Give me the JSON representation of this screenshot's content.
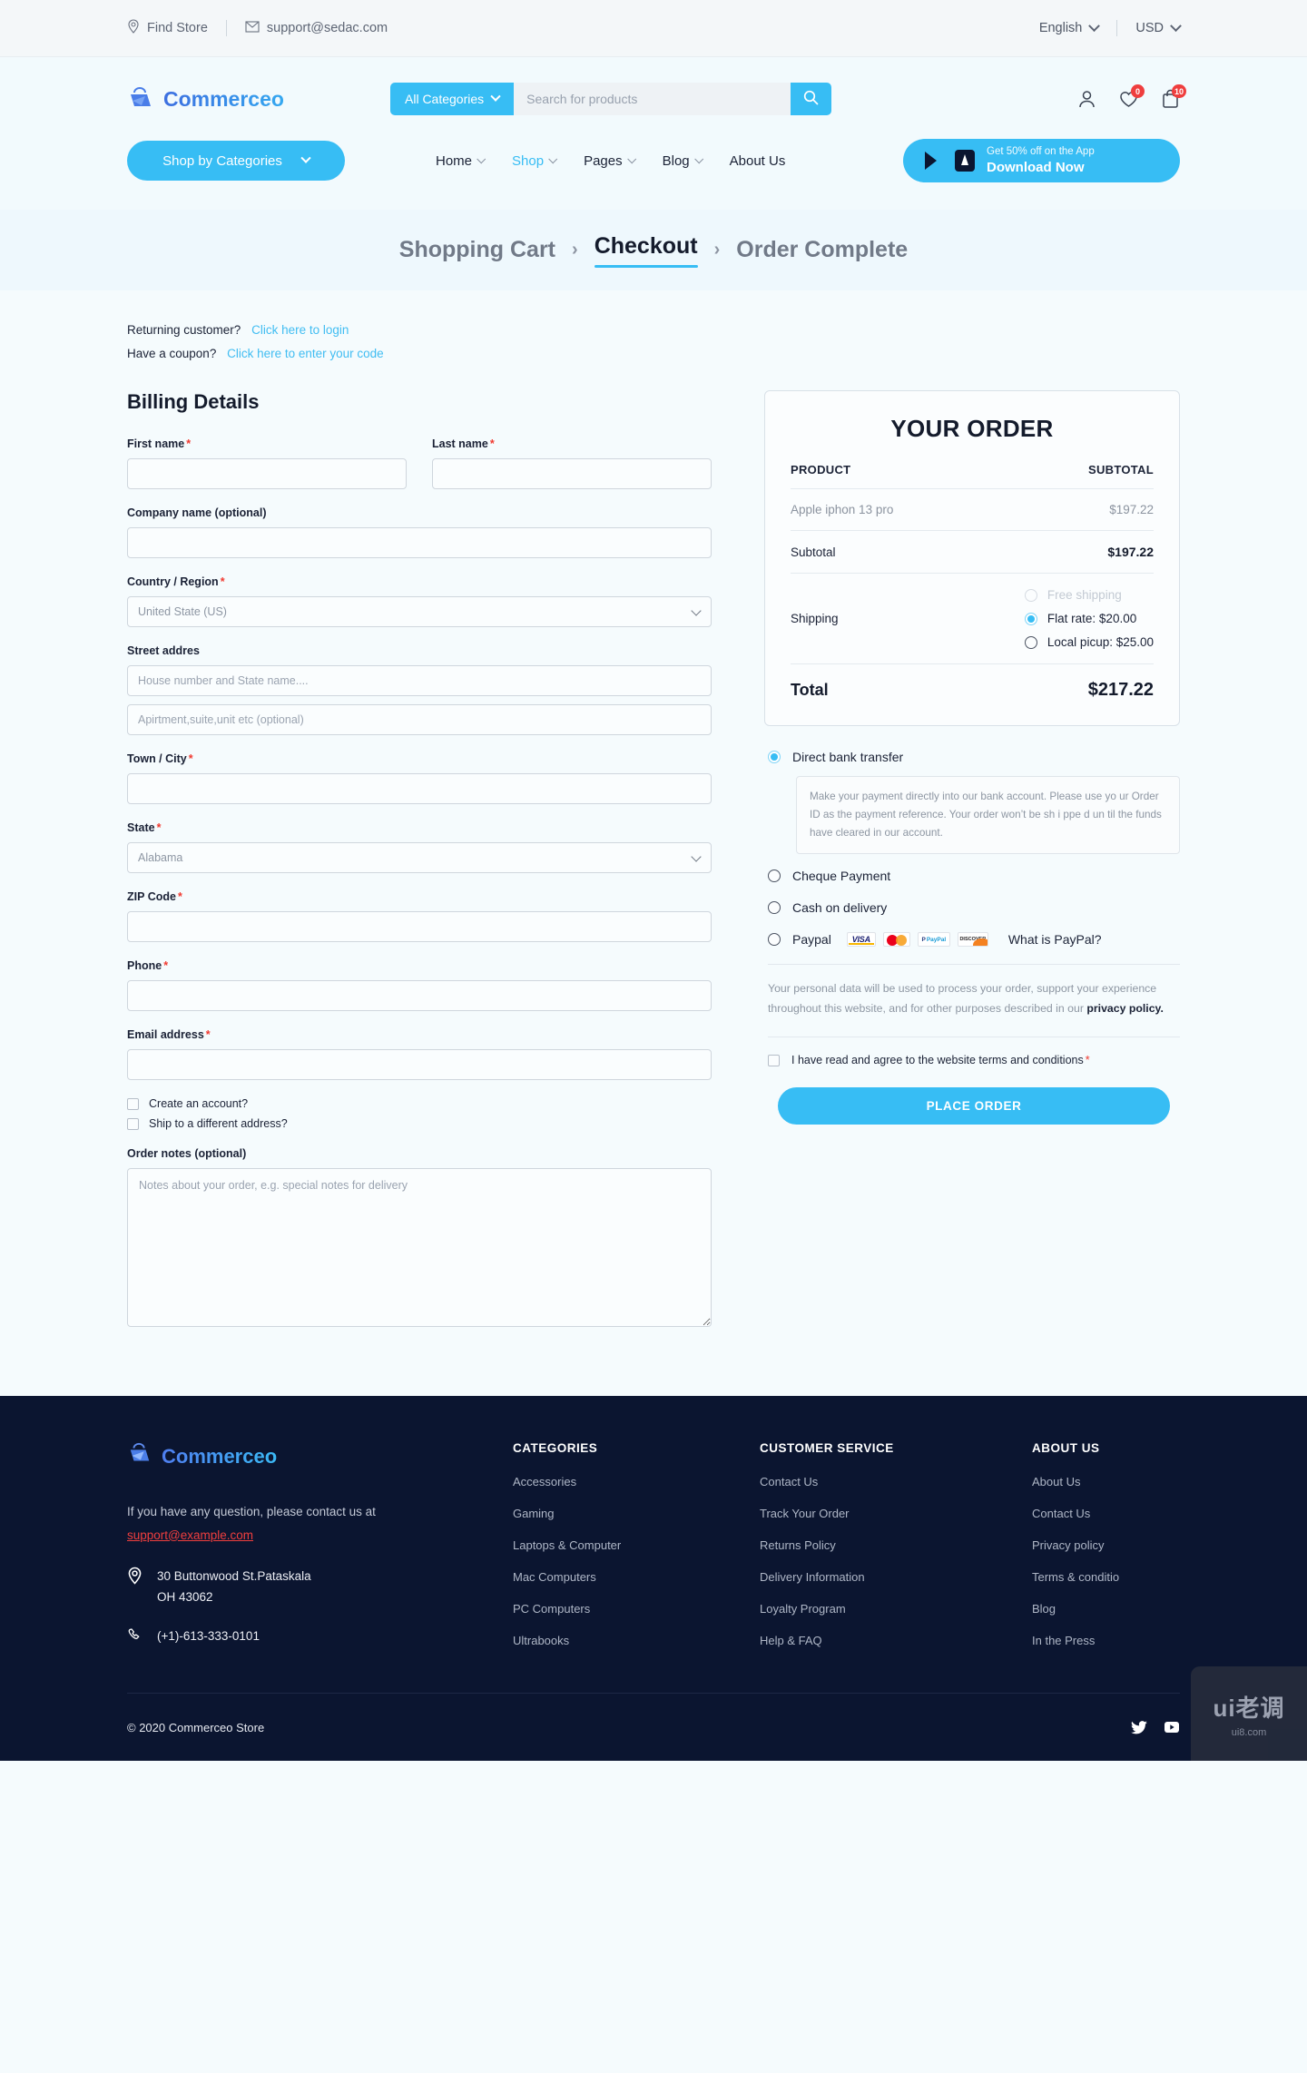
{
  "topbar": {
    "find_store": "Find Store",
    "email": "support@sedac.com",
    "language": "English",
    "currency": "USD"
  },
  "header": {
    "brand": "Commerceo",
    "categories_button": "All Categories",
    "search_placeholder": "Search for products",
    "wishlist_count": "0",
    "cart_count": "10"
  },
  "nav": {
    "shop_by_categories": "Shop by Categories",
    "items": [
      {
        "label": "Home",
        "active": false,
        "has_caret": true
      },
      {
        "label": "Shop",
        "active": true,
        "has_caret": true
      },
      {
        "label": "Pages",
        "active": false,
        "has_caret": true
      },
      {
        "label": "Blog",
        "active": false,
        "has_caret": true
      },
      {
        "label": "About Us",
        "active": false,
        "has_caret": false
      }
    ],
    "app_promo_small": "Get 50% off on the App",
    "app_promo_big": "Download Now"
  },
  "breadcrumb": {
    "step1": "Shopping Cart",
    "step2": "Checkout",
    "step3": "Order Complete",
    "separator": "›"
  },
  "notices": {
    "returning_label": "Returning customer?",
    "returning_link": "Click here to login",
    "coupon_label": "Have a coupon?",
    "coupon_link": "Click here to enter your code"
  },
  "billing": {
    "title": "Billing Details",
    "first_name_label": "First name",
    "last_name_label": "Last name",
    "company_label": "Company name (optional)",
    "country_label": "Country / Region",
    "country_value": "United State (US)",
    "street_label": "Street addres",
    "street_placeholder_1": "House number and State name....",
    "street_placeholder_2": "Apirtment,suite,unit etc (optional)",
    "town_label": "Town / City",
    "state_label": "State",
    "state_value": "Alabama",
    "zip_label": "ZIP Code",
    "phone_label": "Phone",
    "email_label": "Email address",
    "create_account_label": "Create an account?",
    "ship_different_label": "Ship to a different address?",
    "order_notes_label": "Order notes (optional)",
    "order_notes_placeholder": "Notes about your order, e.g. special notes for delivery",
    "required_mark": "*"
  },
  "order": {
    "title": "YOUR ORDER",
    "col_product": "PRODUCT",
    "col_subtotal": "SUBTOTAL",
    "items": [
      {
        "name": "Apple iphon 13 pro",
        "price": "$197.22"
      }
    ],
    "subtotal_label": "Subtotal",
    "subtotal_value": "$197.22",
    "shipping_label": "Shipping",
    "shipping_options": [
      {
        "label": "Free shipping",
        "selected": false,
        "disabled": true
      },
      {
        "label": "Flat rate: $20.00",
        "selected": true,
        "disabled": false
      },
      {
        "label": "Local picup: $25.00",
        "selected": false,
        "disabled": false
      }
    ],
    "total_label": "Total",
    "total_value": "$217.22"
  },
  "payment": {
    "bank_label": "Direct bank transfer",
    "bank_desc": "Make your payment directly into our bank account. Please use yo ur Order ID as the payment reference. Your order won’t be sh i ppe d un til the funds have cleared in our account.",
    "cheque_label": "Cheque Payment",
    "cod_label": "Cash on delivery",
    "paypal_label": "Paypal",
    "paypal_question": "What is PayPal?",
    "card_brands": [
      "VISA",
      "MasterCard",
      "PayPal",
      "DISCOVER"
    ],
    "privacy_text": "Your personal data will be used to process your order, support your experience throughout this website, and for other purposes described in our ",
    "privacy_link": "privacy policy.",
    "terms_text": "I have read and agree to the website terms and conditions",
    "terms_required": "*",
    "place_order_button": "PLACE ORDER"
  },
  "footer": {
    "brand": "Commerceo",
    "contact_intro": "If you have any question, please contact us at",
    "contact_email": "support@example.com",
    "address_line1": "30 Buttonwood St.Pataskala",
    "address_line2": "OH 43062",
    "phone": "(+1)-613-333-0101",
    "columns": [
      {
        "heading": "CATEGORIES",
        "links": [
          "Accessories",
          "Gaming",
          "Laptops & Computer",
          "Mac Computers",
          "PC Computers",
          "Ultrabooks"
        ]
      },
      {
        "heading": "CUSTOMER SERVICE",
        "links": [
          "Contact Us",
          "Track Your Order",
          "Returns Policy",
          "Delivery Information",
          "Loyalty Program",
          "Help & FAQ"
        ]
      },
      {
        "heading": "ABOUT US",
        "links": [
          "About Us",
          "Contact Us",
          "Privacy policy",
          "Terms & conditio",
          "Blog",
          "In the Press"
        ]
      }
    ],
    "copyright": "© 2020 Commerceo Store"
  },
  "watermark": {
    "main": "ui老调",
    "sub": "ui8.com"
  }
}
